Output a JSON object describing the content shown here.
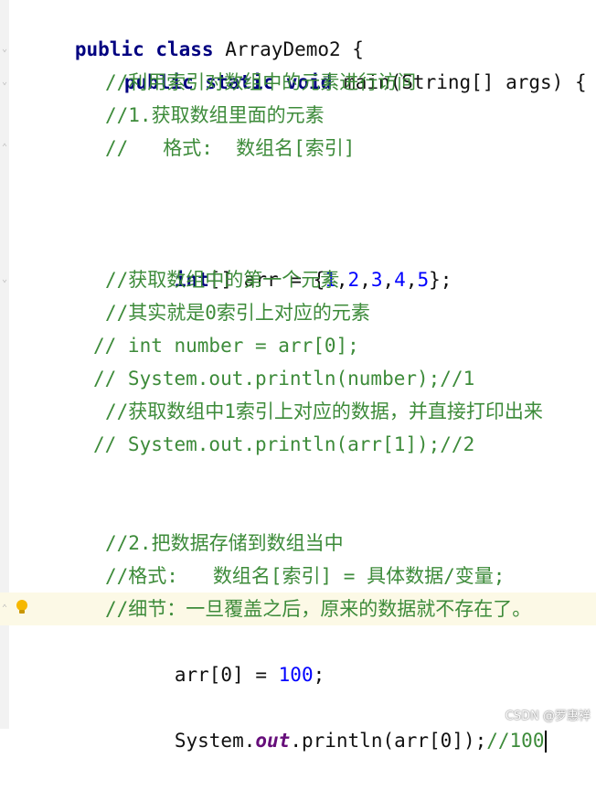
{
  "code": {
    "l1": {
      "kw": "public class ",
      "rest": "ArrayDemo2 {"
    },
    "l2": {
      "kw": "public static void ",
      "rest": "main(String[] args) {"
    },
    "l3": {
      "comment": "//利用索引对数组中的元素进行访问"
    },
    "l4": {
      "comment": "//1.获取数组里面的元素"
    },
    "l5": {
      "comment": "//   格式:  数组名[索引]"
    },
    "l6": {
      "kw": "int",
      "a": "[] arr = {",
      "n1": "1",
      "c1": ",",
      "n2": "2",
      "c2": ",",
      "n3": "3",
      "c3": ",",
      "n4": "4",
      "c4": ",",
      "n5": "5",
      "end": "};"
    },
    "l7": {
      "comment": "//获取数组中的第一个元素"
    },
    "l8": {
      "comment": "//其实就是0索引上对应的元素"
    },
    "l9": {
      "comment": "// int number = arr[0];"
    },
    "l10": {
      "comment": "// System.out.println(number);//1"
    },
    "l11": {
      "comment": "//获取数组中1索引上对应的数据，并直接打印出来"
    },
    "l12": {
      "comment": "// System.out.println(arr[1]);//2"
    },
    "l13": {
      "comment": "//2.把数据存储到数组当中"
    },
    "l14": {
      "comment": "//格式:   数组名[索引] = 具体数据/变量;"
    },
    "l15": {
      "comment": "//细节：一旦覆盖之后，原来的数据就不存在了。"
    },
    "l16": {
      "a": "arr[0] = ",
      "num": "100",
      "end": ";"
    },
    "l17": {
      "a": "System.",
      "field": "out",
      "b": ".println(arr[0]);",
      "comment": "//100"
    }
  },
  "watermark": "CSDN @罗惠祥",
  "icons": {
    "fold": "fold-marker-icon",
    "bulb": "lightbulb-icon"
  }
}
